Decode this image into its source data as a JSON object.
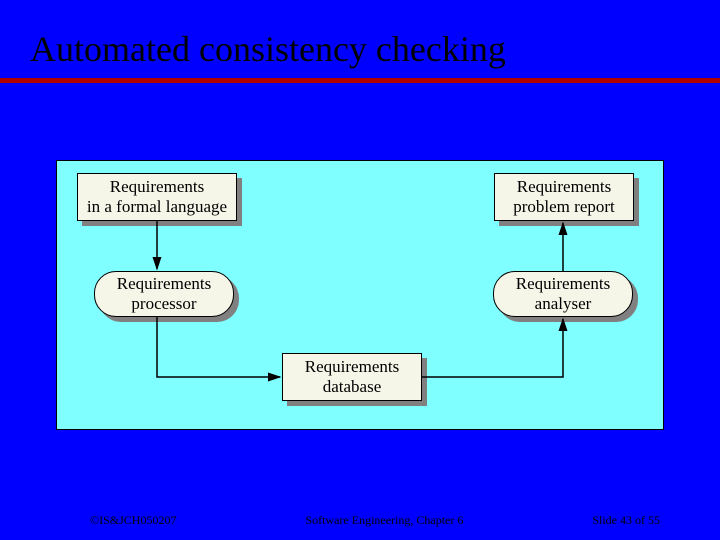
{
  "slide": {
    "title": "Automated consistency checking"
  },
  "diagram": {
    "nodes": {
      "req_formal": {
        "l1": "Requirements",
        "l2": "in a formal language"
      },
      "req_report": {
        "l1": "Requirements",
        "l2": "problem report"
      },
      "req_processor": {
        "l1": "Requirements",
        "l2": "processor"
      },
      "req_analyser": {
        "l1": "Requirements",
        "l2": "analyser"
      },
      "req_database": {
        "l1": "Requirements",
        "l2": "database"
      }
    },
    "flows": [
      {
        "from": "req_formal",
        "to": "req_processor"
      },
      {
        "from": "req_processor",
        "to": "req_database"
      },
      {
        "from": "req_database",
        "to": "req_analyser"
      },
      {
        "from": "req_analyser",
        "to": "req_report"
      }
    ]
  },
  "footer": {
    "copyright": "©IS&JCH050207",
    "center": "Software Engineering, Chapter 6",
    "page": "Slide 43 of 55"
  }
}
